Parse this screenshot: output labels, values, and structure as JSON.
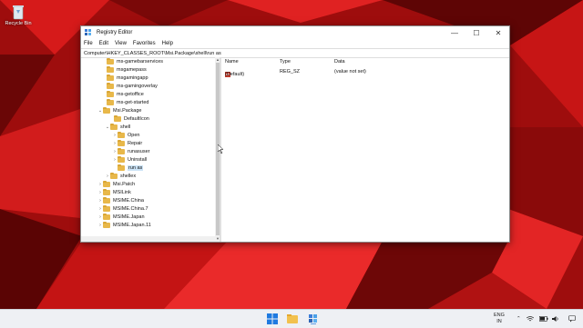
{
  "desktop": {
    "recycle_bin_label": "Recycle Bin"
  },
  "window": {
    "title": "Registry Editor",
    "controls": {
      "minimize": "—",
      "maximize": "☐",
      "close": "✕"
    },
    "menu": [
      "File",
      "Edit",
      "View",
      "Favorites",
      "Help"
    ],
    "address": "Computer\\HKEY_CLASSES_ROOT\\Msi.Package\\shell\\run as"
  },
  "tree": {
    "items": [
      {
        "label": "ms-gamebarservices",
        "expander": ""
      },
      {
        "label": "msgamepass",
        "expander": ""
      },
      {
        "label": "msgamingapp",
        "expander": ""
      },
      {
        "label": "ms-gamingoverlay",
        "expander": ""
      },
      {
        "label": "ms-getoffice",
        "expander": ""
      },
      {
        "label": "ms-get-started",
        "expander": ""
      },
      {
        "label": "Msi.Package",
        "expander": "⌄"
      },
      {
        "label": "DefaultIcon",
        "expander": ""
      },
      {
        "label": "shell",
        "expander": "⌄"
      },
      {
        "label": "Open",
        "expander": "›"
      },
      {
        "label": "Repair",
        "expander": "›"
      },
      {
        "label": "runasuser",
        "expander": "›"
      },
      {
        "label": "Uninstall",
        "expander": "›"
      },
      {
        "label": "run as",
        "expander": ""
      },
      {
        "label": "shellex",
        "expander": "›"
      },
      {
        "label": "Msi.Patch",
        "expander": "›"
      },
      {
        "label": "MSILink",
        "expander": "›"
      },
      {
        "label": "MSIME.China",
        "expander": "›"
      },
      {
        "label": "MSIME.China.7",
        "expander": "›"
      },
      {
        "label": "MSIME.Japan",
        "expander": "›"
      },
      {
        "label": "MSIME.Japan.11",
        "expander": "›"
      }
    ]
  },
  "list": {
    "columns": {
      "name": "Name",
      "type": "Type",
      "data": "Data"
    },
    "rows": [
      {
        "icon": "ab",
        "name": "(Default)",
        "type": "REG_SZ",
        "data": "(value not set)"
      }
    ]
  },
  "taskbar": {
    "language": "ENG",
    "region": "IN"
  }
}
